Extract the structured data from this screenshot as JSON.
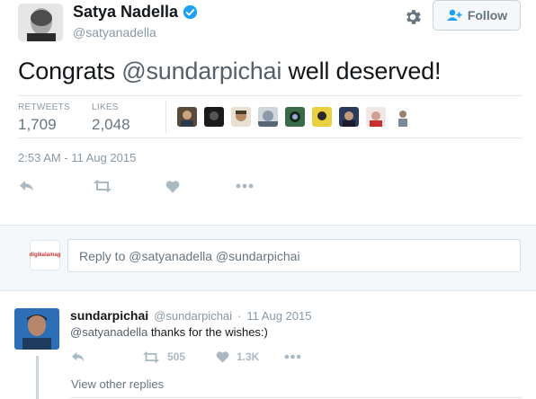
{
  "tweet": {
    "display_name": "Satya Nadella",
    "handle": "@satyanadella",
    "follow_label": "Follow",
    "text_before": "Congrats ",
    "mention": "@sundarpichai",
    "text_after": " well deserved!",
    "retweets_label": "RETWEETS",
    "retweets_count": "1,709",
    "likes_label": "LIKES",
    "likes_count": "2,048",
    "timestamp": "2:53 AM - 11 Aug 2015",
    "icons": [
      "reply-icon",
      "retweet-icon",
      "like-icon",
      "more-icon",
      "gear-icon",
      "verified-badge-icon",
      "follow-person-icon"
    ]
  },
  "reply_box": {
    "logo_text": "digikalamag",
    "placeholder": "Reply to @satyanadella @sundarpichai"
  },
  "reply": {
    "name": "sundarpichai",
    "handle": "@sundarpichai",
    "separator": "·",
    "date": "11 Aug 2015",
    "mention": "@satyanadella",
    "text": " thanks for the wishes:)",
    "retweet_count": "505",
    "like_count": "1.3K",
    "view_replies": "View other replies"
  },
  "colors": {
    "text_dark": "#14171a",
    "text_muted": "#8899a6",
    "icon_muted": "#aab8c2",
    "verified_blue": "#1da1f2",
    "divider": "#e1e8ed",
    "reply_area_bg": "#f5f8fa"
  }
}
